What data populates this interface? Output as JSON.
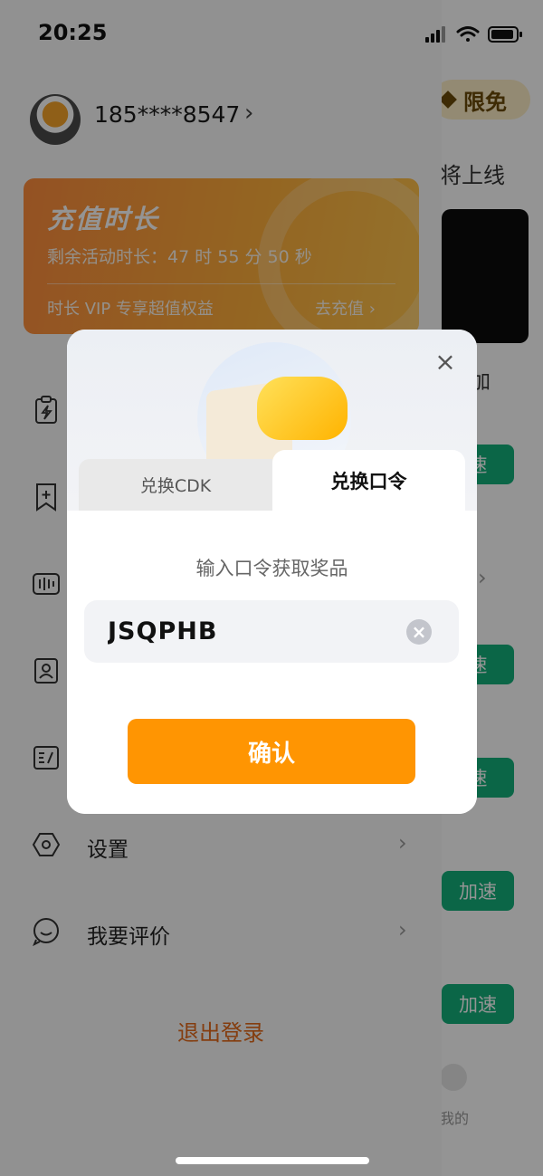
{
  "status_bar": {
    "time": "20:25"
  },
  "main": {
    "promo_badge": "限免",
    "soon_fragment": "将上线",
    "add_fragment": "加",
    "speed_labels": [
      "速",
      "速",
      "速",
      "加速",
      "加速"
    ],
    "mine_label": "我的"
  },
  "drawer": {
    "phone": "185****8547",
    "vip": {
      "title": "充值时长",
      "remaining": "剩余活动时长：47 时 55 分 50 秒",
      "benefit": "时长 VIP 专享超值权益",
      "recharge": "去充值"
    },
    "menu": [
      {
        "label": "设置",
        "icon": "settings-icon"
      },
      {
        "label": "我要评价",
        "icon": "review-icon"
      }
    ],
    "logout": "退出登录"
  },
  "dialog": {
    "tabs": [
      "兑换CDK",
      "兑换口令"
    ],
    "active_tab": "兑换口令",
    "hint": "输入口令获取奖品",
    "input_value": "JSQPHB",
    "confirm_label": "确认"
  },
  "colors": {
    "accent": "#ff9502",
    "speed_button": "#13b07a",
    "logout": "#e46a1a"
  }
}
